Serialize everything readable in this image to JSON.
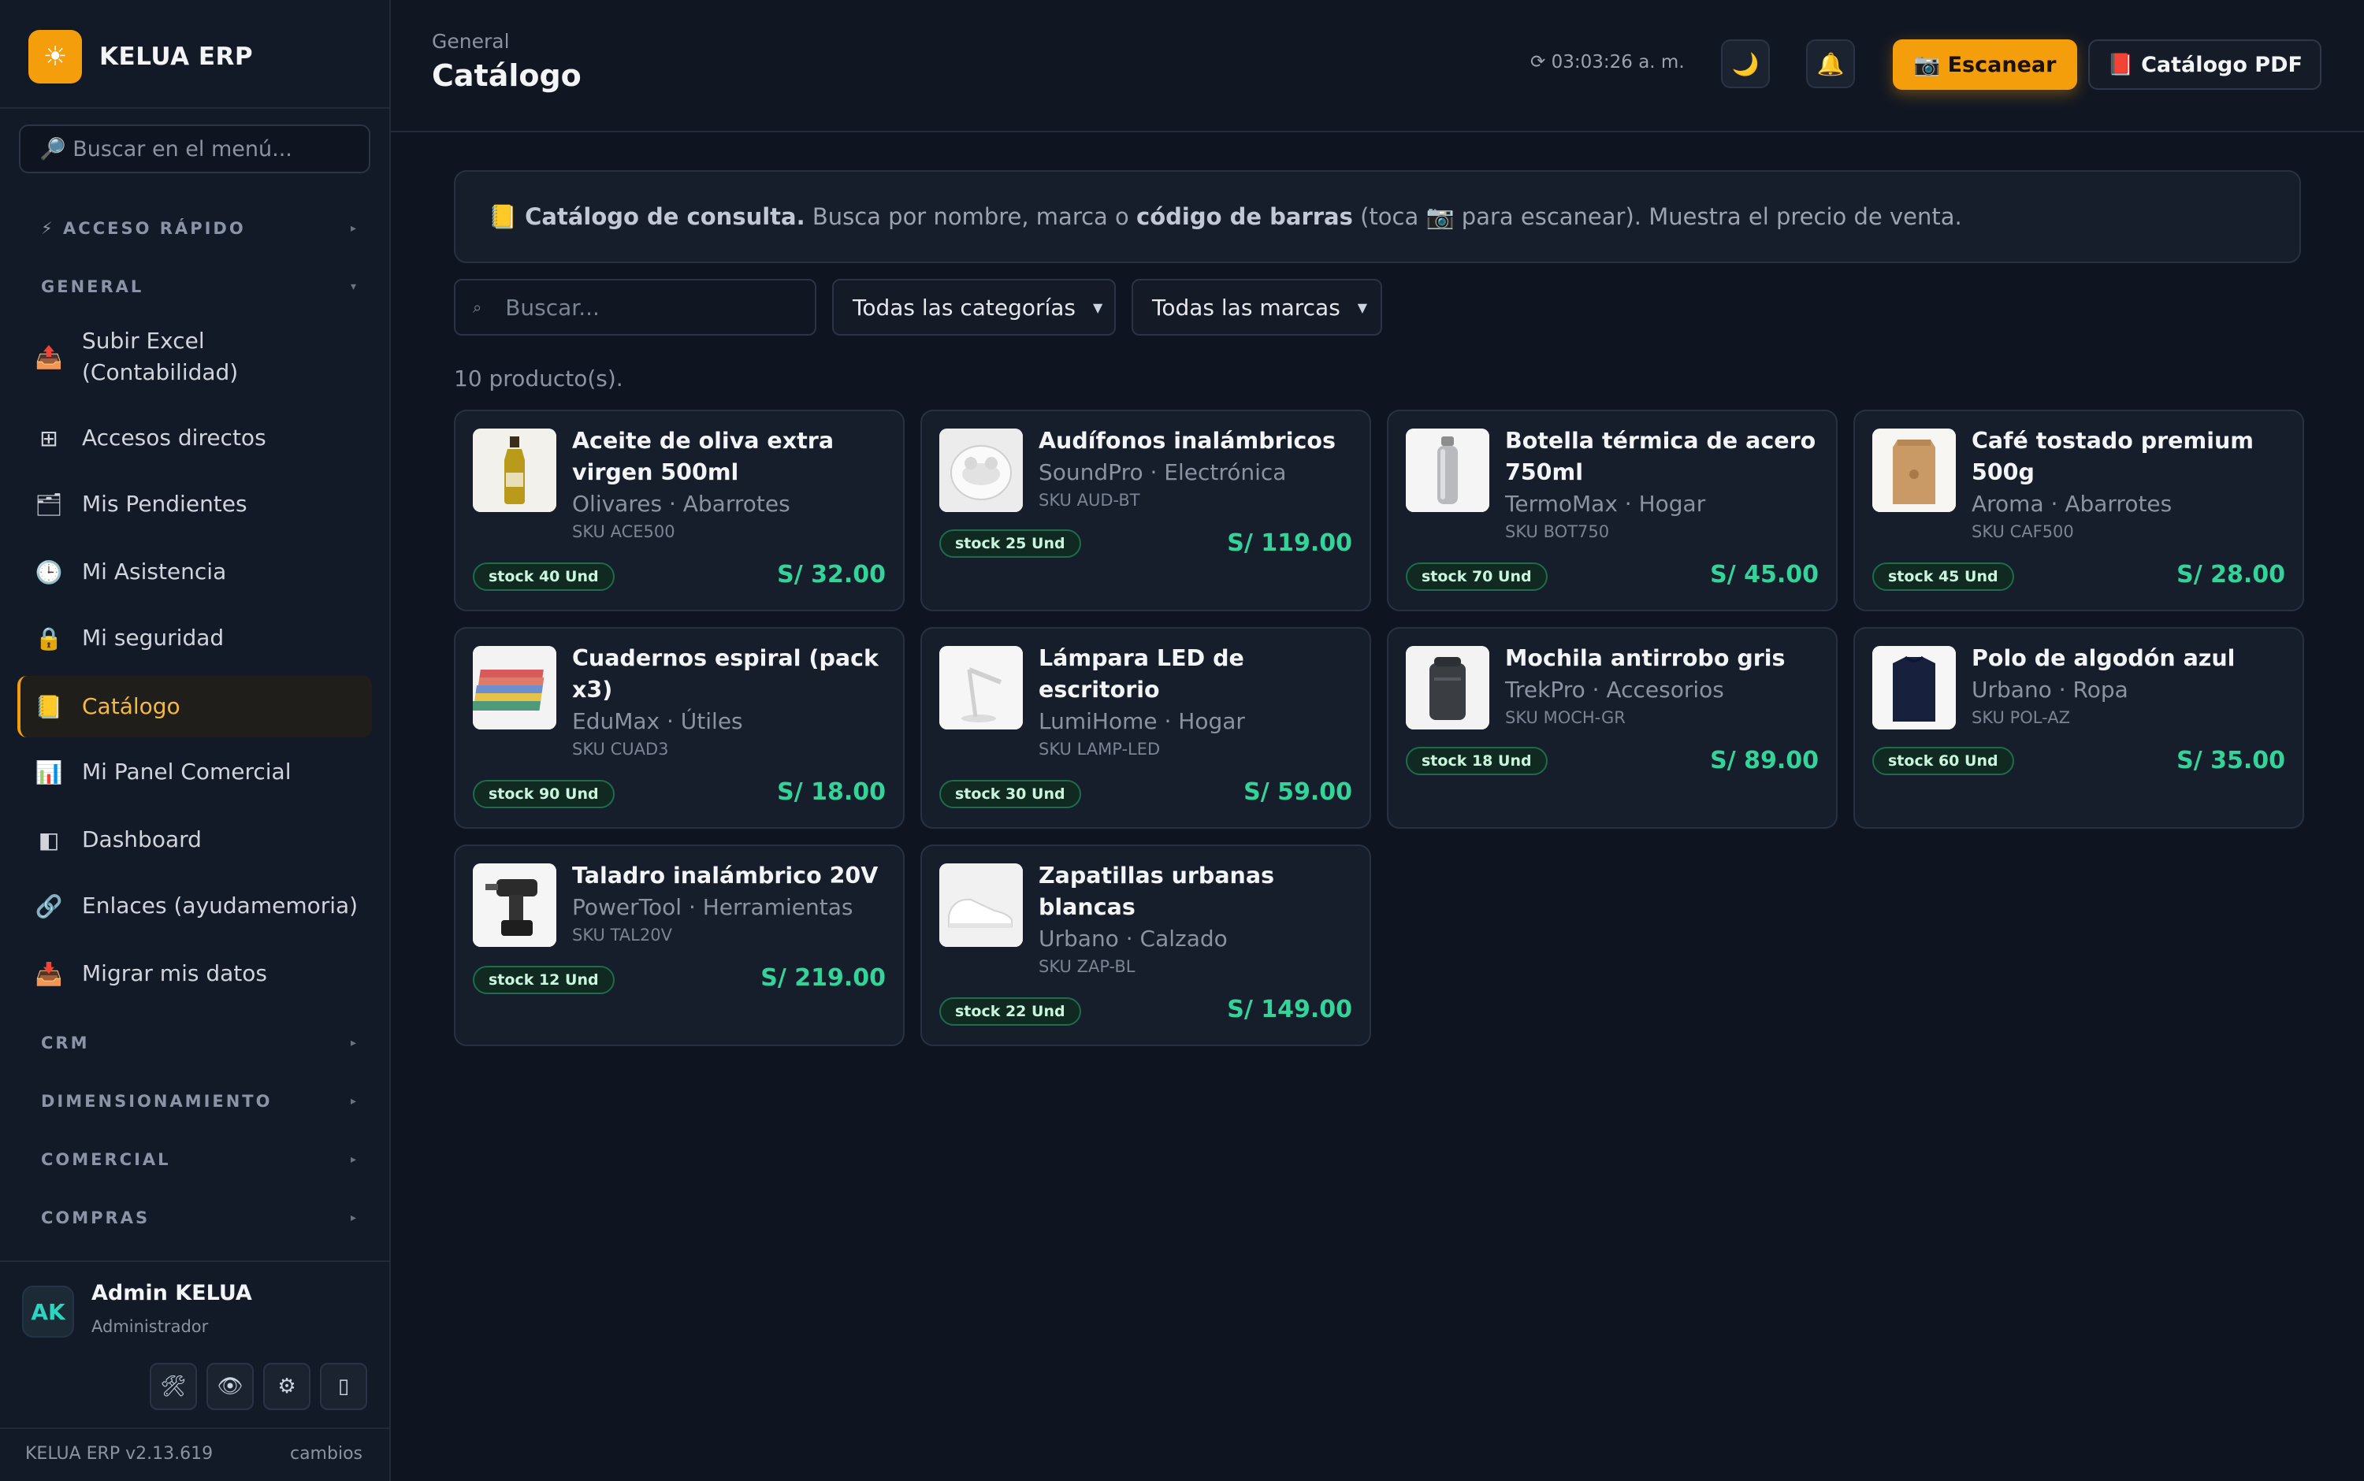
{
  "brand": {
    "name": "KELUA ERP",
    "logo_icon": "☀"
  },
  "sidebar": {
    "search_placeholder": "🔎 Buscar en el menú...",
    "sections": [
      {
        "label": "⚡ ACCESO RÁPIDO",
        "chevron": "▸"
      },
      {
        "label": "GENERAL",
        "chevron": "▾"
      },
      {
        "label": "CRM",
        "chevron": "▸"
      },
      {
        "label": "DIMENSIONAMIENTO",
        "chevron": "▸"
      },
      {
        "label": "COMERCIAL",
        "chevron": "▸"
      },
      {
        "label": "COMPRAS",
        "chevron": "▸"
      }
    ],
    "items": [
      {
        "icon": "📤",
        "label": "Subir Excel",
        "label2": "(Contabilidad)"
      },
      {
        "icon": "⊞",
        "label": "Accesos directos"
      },
      {
        "icon": "🗂",
        "label": "Mis Pendientes"
      },
      {
        "icon": "🕒",
        "label": "Mi Asistencia"
      },
      {
        "icon": "🔒",
        "label": "Mi seguridad"
      },
      {
        "icon": "📒",
        "label": "Catálogo"
      },
      {
        "icon": "📊",
        "label": "Mi Panel Comercial"
      },
      {
        "icon": "◧",
        "label": "Dashboard"
      },
      {
        "icon": "🔗",
        "label": "Enlaces (ayudamemoria)"
      },
      {
        "icon": "📥",
        "label": "Migrar mis datos"
      }
    ],
    "user": {
      "initials": "AK",
      "name": "Admin KELUA",
      "role": "Administrador"
    },
    "user_buttons": [
      "🛠",
      "👁",
      "⚙",
      "▯"
    ],
    "version": "KELUA ERP v2.13.619",
    "changes_link": "cambios"
  },
  "header": {
    "breadcrumb": "General",
    "title": "Catálogo",
    "clock": "⟳ 03:03:26 a. m.",
    "theme_icon": "🌙",
    "bell_icon": "🔔",
    "scan_label": "📷 Escanear",
    "pdf_label": "📕 Catálogo PDF"
  },
  "info": {
    "icon": "📒",
    "bold1": "Catálogo de consulta.",
    "text1": " Busca por nombre, marca o ",
    "bold2": "código de barras",
    "text2": " (toca 📷 para escanear). Muestra el precio de venta."
  },
  "filters": {
    "search_placeholder": "Buscar...",
    "search_icon": "⌕",
    "category": "Todas las categorías",
    "brand": "Todas las marcas"
  },
  "count_text": "10 producto(s).",
  "products": [
    {
      "name": "Aceite de oliva extra virgen 500ml",
      "meta": "Olivares · Abarrotes",
      "sku": "SKU ACE500",
      "stock": "stock 40 Und",
      "price": "S/ 32.00",
      "thumb": "bottle-oil"
    },
    {
      "name": "Audífonos inalámbricos",
      "meta": "SoundPro · Electrónica",
      "sku": "SKU AUD-BT",
      "stock": "stock 25 Und",
      "price": "S/ 119.00",
      "thumb": "earbuds"
    },
    {
      "name": "Botella térmica de acero 750ml",
      "meta": "TermoMax · Hogar",
      "sku": "SKU BOT750",
      "stock": "stock 70 Und",
      "price": "S/ 45.00",
      "thumb": "thermos"
    },
    {
      "name": "Café tostado premium 500g",
      "meta": "Aroma · Abarrotes",
      "sku": "SKU CAF500",
      "stock": "stock 45 Und",
      "price": "S/ 28.00",
      "thumb": "coffee-bag"
    },
    {
      "name": "Cuadernos espiral (pack x3)",
      "meta": "EduMax · Útiles",
      "sku": "SKU CUAD3",
      "stock": "stock 90 Und",
      "price": "S/ 18.00",
      "thumb": "notebooks"
    },
    {
      "name": "Lámpara LED de escritorio",
      "meta": "LumiHome · Hogar",
      "sku": "SKU LAMP-LED",
      "stock": "stock 30 Und",
      "price": "S/ 59.00",
      "thumb": "lamp"
    },
    {
      "name": "Mochila antirrobo gris",
      "meta": "TrekPro · Accesorios",
      "sku": "SKU MOCH-GR",
      "stock": "stock 18 Und",
      "price": "S/ 89.00",
      "thumb": "backpack"
    },
    {
      "name": "Polo de algodón azul",
      "meta": "Urbano · Ropa",
      "sku": "SKU POL-AZ",
      "stock": "stock 60 Und",
      "price": "S/ 35.00",
      "thumb": "tshirt"
    },
    {
      "name": "Taladro inalámbrico 20V",
      "meta": "PowerTool · Herramientas",
      "sku": "SKU TAL20V",
      "stock": "stock 12 Und",
      "price": "S/ 219.00",
      "thumb": "drill"
    },
    {
      "name": "Zapatillas urbanas blancas",
      "meta": "Urbano · Calzado",
      "sku": "SKU ZAP-BL",
      "stock": "stock 22 Und",
      "price": "S/ 149.00",
      "thumb": "sneakers"
    }
  ],
  "colors": {
    "accent": "#f59e0b",
    "price": "#34d399",
    "background": "#0f1520"
  }
}
